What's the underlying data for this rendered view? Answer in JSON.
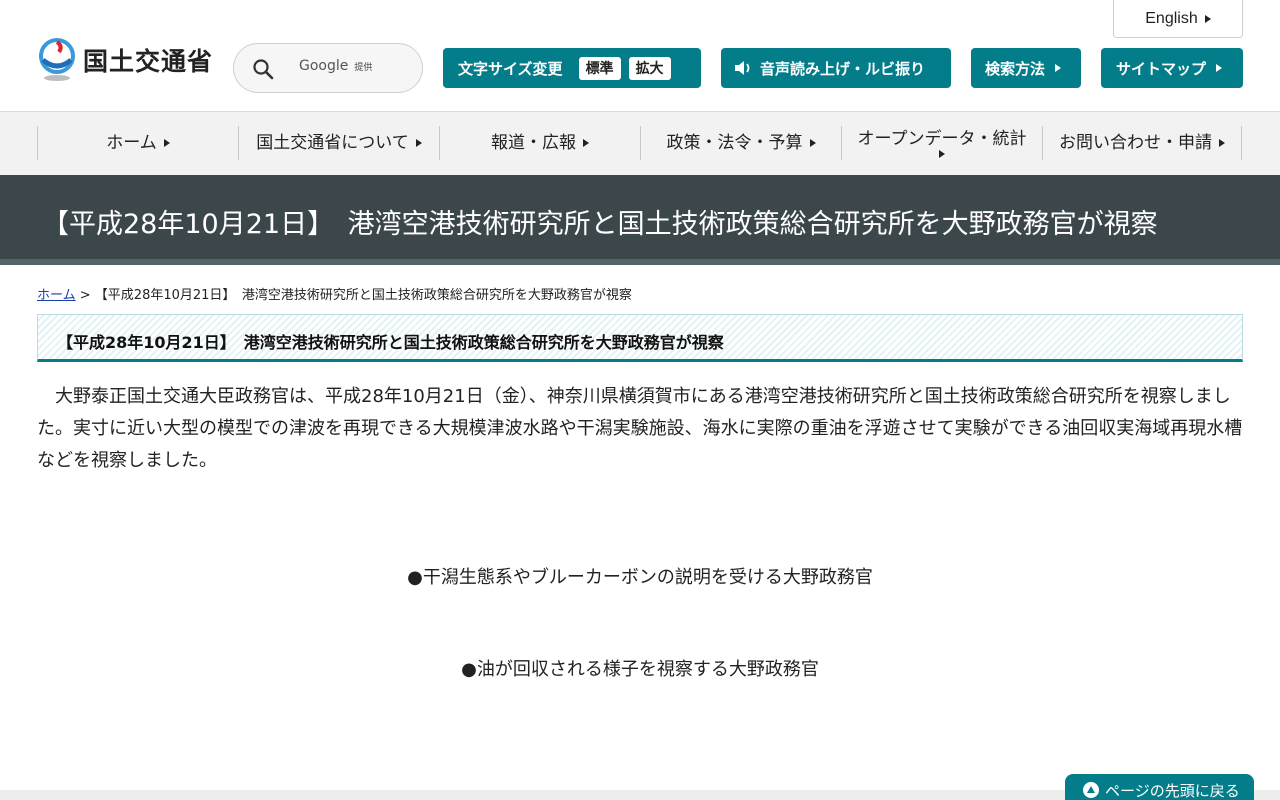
{
  "header": {
    "logo_text": "国土交通省",
    "english_label": "English",
    "search": {
      "provider": "Google",
      "provider_suffix": "提供"
    },
    "font_size": {
      "label": "文字サイズ変更",
      "standard": "標準",
      "large": "拡大"
    },
    "speech_label": "音声読み上げ・ルビ振り",
    "search_method_label": "検索方法",
    "sitemap_label": "サイトマップ"
  },
  "nav": {
    "items": [
      {
        "label": "ホーム"
      },
      {
        "label": "国土交通省について"
      },
      {
        "label": "報道・広報"
      },
      {
        "label": "政策・法令・予算"
      },
      {
        "label": "オープンデータ・統計"
      },
      {
        "label": "お問い合わせ・申請"
      }
    ]
  },
  "page": {
    "title": "【平成28年10月21日】　港湾空港技術研究所と国土技術政策総合研究所を大野政務官が視察",
    "breadcrumb": {
      "home": "ホーム",
      "separator": " > ",
      "current": "【平成28年10月21日】　港湾空港技術研究所と国土技術政策総合研究所を大野政務官が視察"
    },
    "heading": "【平成28年10月21日】　港湾空港技術研究所と国土技術政策総合研究所を大野政務官が視察",
    "body": "大野泰正国土交通大臣政務官は、平成28年10月21日（金）、神奈川県横須賀市にある港湾空港技術研究所と国土技術政策総合研究所を視察しました。実寸に近い大型の模型での津波を再現できる大規模津波水路や干潟実験施設、海水に実際の重油を浮遊させて実験ができる油回収実海域再現水槽などを視察しました。",
    "captions": [
      "●干潟生態系やブルーカーボンの説明を受ける大野政務官",
      "●油が回収される様子を視察する大野政務官"
    ]
  },
  "footer": {
    "page_top_label": "ページの先頭に戻る"
  },
  "colors": {
    "accent": "#047d8b",
    "banner": "#3c474c"
  }
}
